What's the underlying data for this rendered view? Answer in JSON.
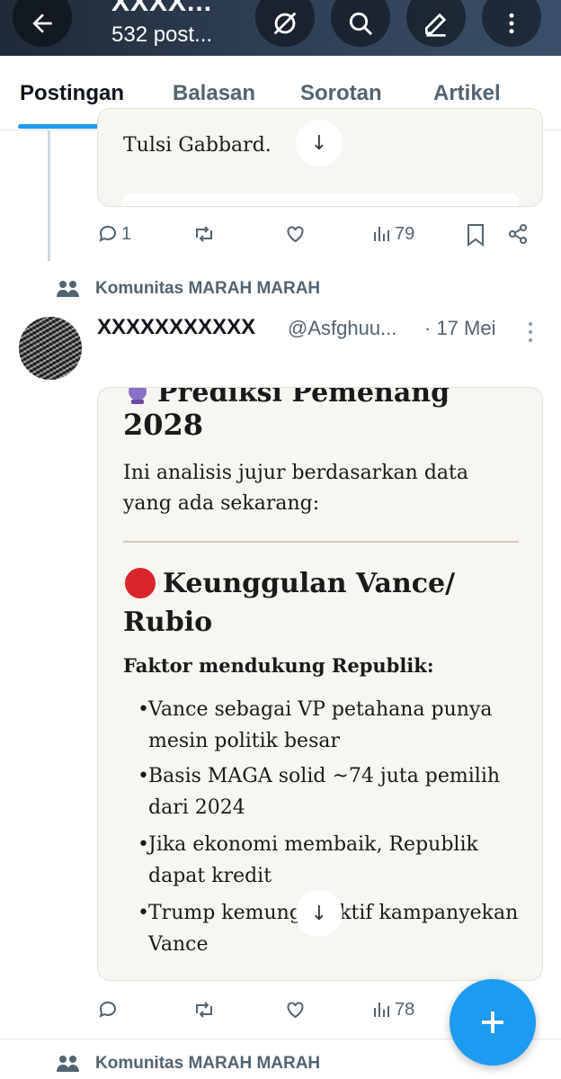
{
  "header": {
    "name": "XXXX...",
    "post_count": "532 post..."
  },
  "tabs": [
    {
      "label": "Postingan",
      "active": true
    },
    {
      "label": "Balasan",
      "active": false
    },
    {
      "label": "Sorotan",
      "active": false
    },
    {
      "label": "Artikel",
      "active": false
    }
  ],
  "previous_post": {
    "card_text_tail": "Tulsi Gabbard.",
    "actions": {
      "replies": "1",
      "views": "79"
    }
  },
  "post": {
    "community": "Komunitas MARAH MARAH",
    "author": "XXXXXXXXXXX",
    "handle": "@Asfghuu...",
    "date": "· 17 Mei",
    "card": {
      "heading_top": "Prediksi Pemenang",
      "heading_year": "2028",
      "intro": "Ini analisis jujur berdasarkan data yang ada sekarang:",
      "section_title": "Keunggulan Vance/ Rubio",
      "factor_title": "Faktor mendukung Republik:",
      "bullets": [
        "Vance sebagai VP petahana punya mesin politik besar",
        "Basis MAGA solid ~74 juta pemilih dari 2024",
        "Jika ekonomi membaik, Republik dapat kredit",
        "Trump kemung      n aktif kampanyekan Vance"
      ]
    },
    "actions": {
      "views": "78"
    }
  },
  "next_post": {
    "community": "Komunitas MARAH MARAH"
  },
  "colors": {
    "accent": "#1d9bf0",
    "muted": "#536471",
    "red_dot": "#d8262c"
  }
}
